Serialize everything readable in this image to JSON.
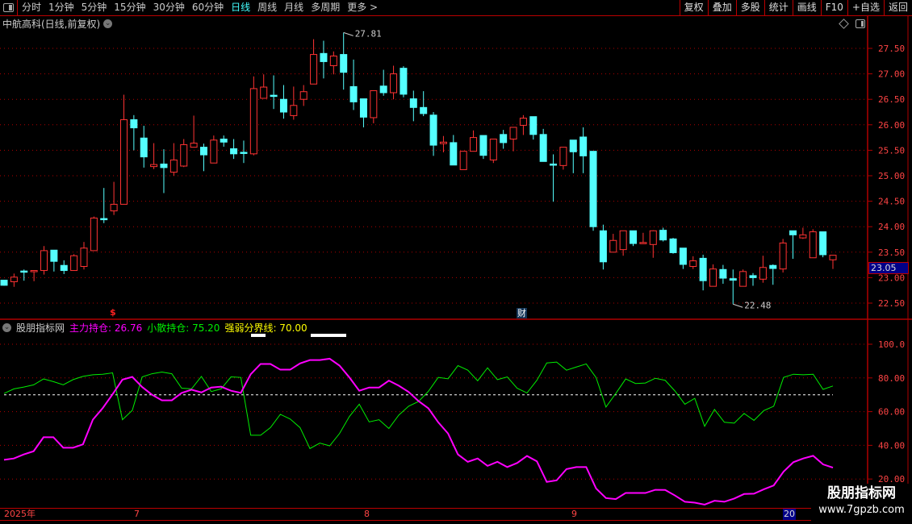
{
  "toolbar": {
    "periods": [
      "分时",
      "1分钟",
      "5分钟",
      "15分钟",
      "30分钟",
      "60分钟",
      "日线",
      "周线",
      "月线",
      "多周期",
      "更多 >"
    ],
    "active_period": "日线",
    "buttons": [
      "复权",
      "叠加",
      "多股",
      "统计",
      "画线",
      "F10",
      "+自选",
      "返回"
    ]
  },
  "chart_title": "中航高科(日线,前复权)",
  "price_axis": [
    "27.50",
    "27.00",
    "26.50",
    "26.00",
    "25.50",
    "25.00",
    "24.50",
    "24.00",
    "23.50",
    "23.00",
    "22.50"
  ],
  "current_price": "23.05",
  "annotations": {
    "high": "27.81",
    "low": "22.48",
    "marker_s": "$",
    "marker_cai": "财"
  },
  "indicator": {
    "name": "股朋指标网",
    "main_label": "主力持仓: 26.76",
    "retail_label": "小散持仓: 75.20",
    "threshold_label": "强弱分界线: 70.00",
    "axis": [
      "100.0",
      "80.00",
      "60.00",
      "40.00",
      "20.00"
    ]
  },
  "date_axis": [
    "2025年",
    "7",
    "8",
    "9",
    "20"
  ],
  "watermark": {
    "name": "股朋指标网",
    "url": "www.7gpzb.com"
  },
  "colors": {
    "up": "#ff3333",
    "down": "#54ffff",
    "main": "#ff00ff",
    "retail": "#00ee00",
    "threshold": "#ffff00",
    "grid": "#b00000"
  },
  "chart_data": [
    {
      "type": "candlestick",
      "ylim": [
        22.3,
        27.9
      ],
      "ohlc": [
        [
          22.95,
          22.95,
          22.84,
          22.85
        ],
        [
          22.92,
          23.08,
          22.82,
          23.01
        ],
        [
          23.13,
          23.16,
          22.94,
          23.11
        ],
        [
          23.13,
          23.14,
          22.93,
          23.14
        ],
        [
          23.14,
          23.62,
          23.06,
          23.53
        ],
        [
          23.54,
          23.54,
          23.12,
          23.32
        ],
        [
          23.24,
          23.34,
          23.07,
          23.14
        ],
        [
          23.14,
          23.46,
          23.14,
          23.43
        ],
        [
          23.22,
          23.7,
          23.16,
          23.58
        ],
        [
          23.53,
          24.2,
          23.53,
          24.17
        ],
        [
          24.16,
          24.76,
          24.07,
          24.15
        ],
        [
          24.31,
          24.88,
          24.23,
          24.44
        ],
        [
          24.44,
          26.59,
          24.44,
          26.1
        ],
        [
          26.1,
          26.19,
          25.5,
          25.94
        ],
        [
          25.74,
          25.98,
          25.16,
          25.37
        ],
        [
          25.18,
          25.64,
          25.13,
          25.22
        ],
        [
          25.23,
          25.52,
          24.66,
          25.16
        ],
        [
          25.07,
          25.64,
          25.0,
          25.31
        ],
        [
          25.19,
          25.72,
          25.17,
          25.61
        ],
        [
          25.56,
          26.18,
          25.56,
          25.64
        ],
        [
          25.56,
          25.63,
          25.09,
          25.41
        ],
        [
          25.25,
          25.79,
          25.25,
          25.7
        ],
        [
          25.72,
          25.79,
          25.57,
          25.66
        ],
        [
          25.53,
          25.72,
          25.33,
          25.43
        ],
        [
          25.46,
          25.69,
          25.25,
          25.45
        ],
        [
          25.43,
          26.95,
          25.4,
          26.71
        ],
        [
          26.52,
          26.99,
          26.52,
          26.74
        ],
        [
          26.58,
          26.97,
          26.31,
          26.57
        ],
        [
          26.5,
          26.78,
          26.12,
          26.25
        ],
        [
          26.18,
          26.75,
          26.1,
          26.38
        ],
        [
          26.5,
          26.78,
          26.37,
          26.65
        ],
        [
          26.8,
          27.68,
          26.8,
          27.38
        ],
        [
          27.4,
          27.65,
          26.91,
          27.24
        ],
        [
          27.16,
          27.44,
          26.99,
          27.35
        ],
        [
          27.38,
          27.81,
          26.69,
          27.03
        ],
        [
          26.75,
          27.28,
          26.29,
          26.45
        ],
        [
          26.51,
          26.51,
          25.95,
          26.15
        ],
        [
          26.14,
          26.67,
          26.03,
          26.67
        ],
        [
          26.76,
          27.08,
          26.57,
          26.63
        ],
        [
          26.63,
          27.16,
          26.5,
          27.0
        ],
        [
          27.11,
          27.15,
          26.54,
          26.6
        ],
        [
          26.51,
          26.67,
          26.07,
          26.34
        ],
        [
          26.34,
          26.66,
          26.17,
          26.22
        ],
        [
          26.19,
          26.25,
          25.39,
          25.6
        ],
        [
          25.63,
          25.78,
          25.46,
          25.66
        ],
        [
          25.65,
          25.8,
          25.21,
          25.21
        ],
        [
          25.12,
          25.48,
          25.12,
          25.48
        ],
        [
          25.48,
          25.89,
          25.48,
          25.75
        ],
        [
          25.79,
          25.79,
          25.33,
          25.4
        ],
        [
          25.31,
          25.72,
          25.25,
          25.72
        ],
        [
          25.81,
          25.9,
          25.53,
          25.65
        ],
        [
          25.72,
          25.95,
          25.48,
          25.95
        ],
        [
          25.99,
          26.19,
          25.8,
          26.13
        ],
        [
          26.16,
          26.16,
          25.71,
          25.81
        ],
        [
          25.81,
          25.92,
          25.28,
          25.28
        ],
        [
          25.23,
          25.42,
          24.49,
          25.22
        ],
        [
          25.2,
          25.56,
          25.12,
          25.56
        ],
        [
          25.7,
          25.7,
          25.05,
          25.47
        ],
        [
          25.76,
          25.95,
          25.05,
          25.39
        ],
        [
          25.48,
          25.48,
          23.92,
          24.0
        ],
        [
          23.92,
          24.04,
          23.16,
          23.31
        ],
        [
          23.5,
          23.86,
          23.5,
          23.73
        ],
        [
          23.55,
          23.92,
          23.43,
          23.92
        ],
        [
          23.92,
          23.92,
          23.62,
          23.67
        ],
        [
          23.68,
          23.88,
          23.67,
          23.69
        ],
        [
          23.65,
          23.93,
          23.39,
          23.92
        ],
        [
          23.93,
          23.98,
          23.71,
          23.74
        ],
        [
          23.76,
          23.78,
          23.47,
          23.49
        ],
        [
          23.58,
          23.58,
          23.17,
          23.26
        ],
        [
          23.22,
          23.42,
          23.17,
          23.33
        ],
        [
          23.38,
          23.45,
          22.75,
          22.94
        ],
        [
          22.83,
          23.26,
          22.83,
          23.17
        ],
        [
          23.16,
          23.25,
          22.88,
          22.99
        ],
        [
          22.98,
          23.16,
          22.48,
          22.95
        ],
        [
          22.83,
          23.16,
          22.83,
          23.12
        ],
        [
          23.04,
          23.09,
          22.84,
          23.0
        ],
        [
          22.97,
          23.43,
          22.9,
          23.2
        ],
        [
          23.24,
          23.26,
          22.86,
          23.18
        ],
        [
          23.17,
          23.76,
          23.1,
          23.68
        ],
        [
          23.92,
          23.92,
          23.37,
          23.84
        ],
        [
          23.78,
          23.98,
          23.76,
          23.84
        ],
        [
          23.39,
          23.95,
          23.39,
          23.9
        ],
        [
          23.9,
          23.9,
          23.4,
          23.45
        ],
        [
          23.35,
          23.44,
          23.17,
          23.44
        ]
      ]
    },
    {
      "type": "line",
      "ylim": [
        10,
        110
      ],
      "series": [
        {
          "name": "主力持仓",
          "values": [
            31.4,
            32.2,
            34.6,
            36.5,
            44.8,
            44.8,
            38.6,
            38.6,
            40.6,
            55.2,
            62.1,
            70.3,
            79.0,
            80.6,
            74.6,
            70.0,
            66.7,
            66.7,
            71.1,
            73.0,
            71.4,
            74.3,
            74.8,
            72.4,
            71.1,
            82.2,
            88.3,
            88.3,
            84.9,
            84.9,
            88.6,
            90.6,
            90.6,
            91.4,
            87.3,
            80.3,
            72.4,
            74.3,
            74.3,
            78.4,
            75.4,
            71.7,
            66.3,
            62.0,
            53.7,
            47.0,
            34.6,
            30.2,
            32.2,
            27.8,
            30.2,
            27.1,
            29.5,
            33.7,
            30.5,
            18.3,
            19.2,
            25.9,
            27.1,
            27.1,
            14.4,
            8.7,
            8.1,
            11.7,
            11.7,
            11.7,
            13.6,
            13.5,
            10.2,
            6.5,
            6.0,
            4.8,
            7.1,
            6.5,
            8.4,
            11.1,
            11.3,
            13.9,
            16.2,
            24.4,
            30.0,
            32.2,
            33.8,
            28.7,
            26.76
          ]
        },
        {
          "name": "小散持仓",
          "values": [
            70.8,
            73.5,
            74.6,
            75.9,
            79.4,
            77.8,
            75.9,
            79.0,
            80.9,
            81.9,
            82.2,
            83.0,
            55.2,
            60.8,
            80.6,
            82.5,
            83.5,
            82.5,
            73.9,
            73.5,
            80.9,
            71.9,
            73.5,
            80.6,
            80.3,
            46.0,
            46.0,
            50.5,
            58.4,
            55.6,
            50.5,
            38.1,
            41.3,
            39.7,
            47.0,
            57.1,
            64.4,
            53.9,
            55.2,
            50.0,
            57.9,
            63.2,
            66.0,
            72.0,
            80.3,
            79.5,
            87.3,
            84.6,
            78.3,
            86.0,
            79.0,
            80.6,
            73.9,
            71.1,
            78.6,
            88.9,
            89.4,
            84.6,
            86.5,
            88.3,
            80.2,
            62.7,
            70.8,
            79.4,
            76.7,
            77.0,
            79.8,
            78.6,
            72.2,
            64.4,
            67.9,
            51.3,
            61.3,
            53.7,
            53.2,
            58.9,
            54.8,
            60.6,
            63.2,
            80.3,
            82.2,
            81.9,
            82.2,
            73.2,
            75.2
          ]
        },
        {
          "name": "强弱分界线",
          "value": 70
        }
      ]
    }
  ]
}
